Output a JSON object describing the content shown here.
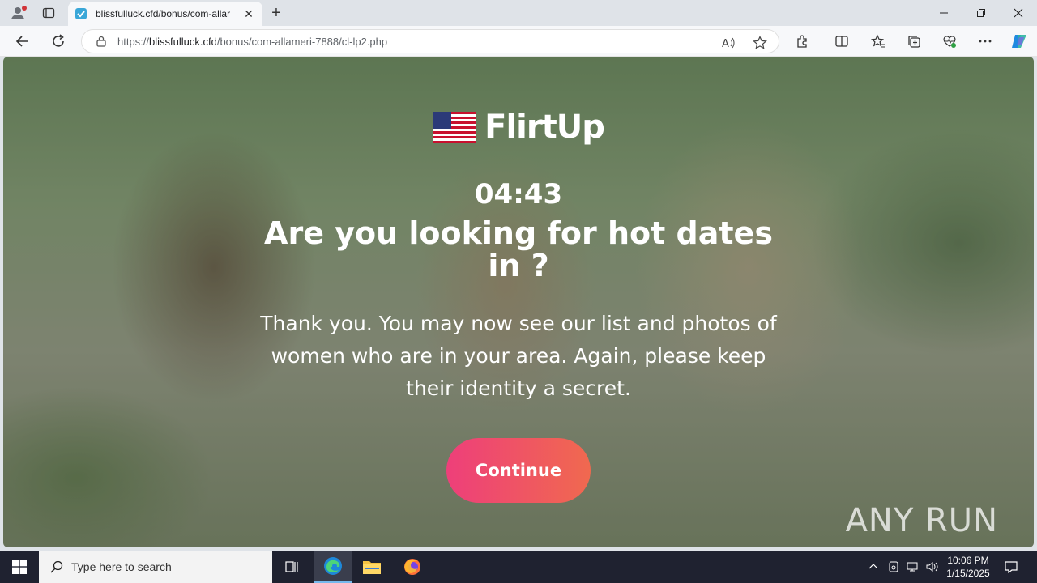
{
  "browser": {
    "tab_title": "blissfulluck.cfd/bonus/com-allar",
    "url_domain": "blissfulluck.cfd",
    "url_prefix": "https://",
    "url_path": "/bonus/com-allameri-7888/cl-lp2.php",
    "window_controls": [
      "minimize-icon",
      "restore-icon",
      "close-icon"
    ]
  },
  "page": {
    "brand_name": "FlirtUp",
    "timer": "04:43",
    "headline": "Are you looking for hot dates in ?",
    "message": "Thank you. You may now see our list and photos of women who are in your area. Again, please keep their identity a secret.",
    "cta_label": "Continue",
    "watermark": "ANY RUN"
  },
  "taskbar": {
    "search_placeholder": "Type here to search",
    "time": "10:06 PM",
    "date": "1/15/2025"
  },
  "colors": {
    "cta_start": "#ee3f7a",
    "cta_end": "#f0694f",
    "taskbar_bg": "#1f2230"
  }
}
